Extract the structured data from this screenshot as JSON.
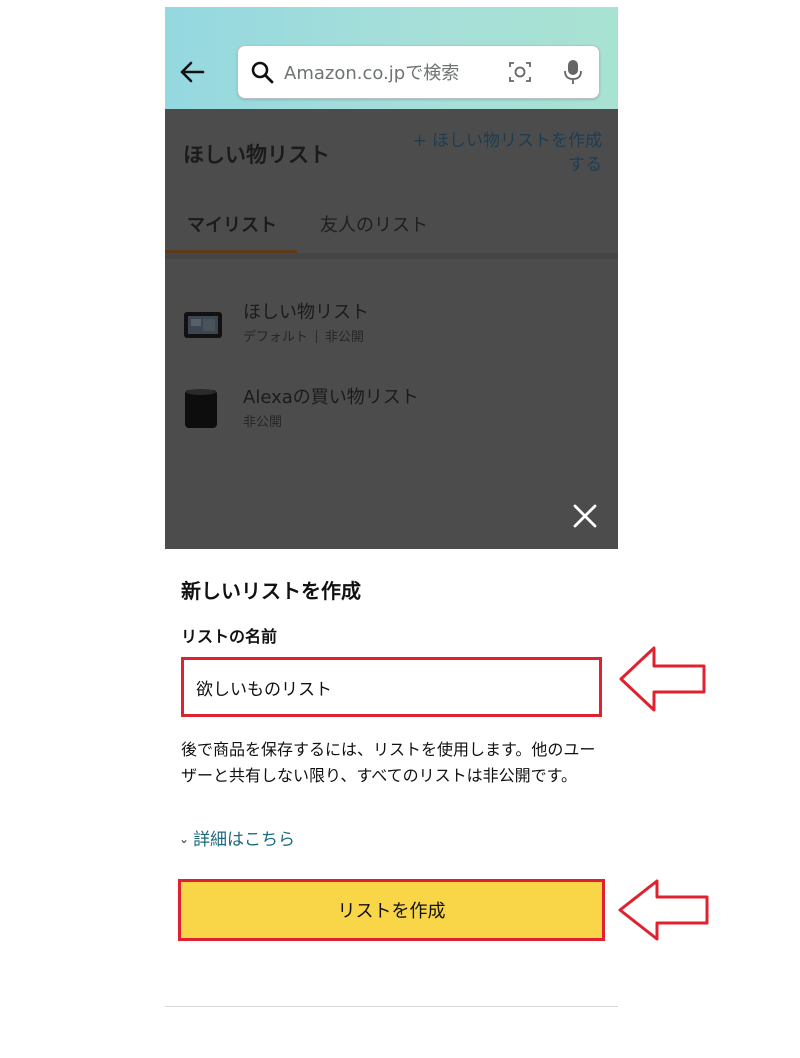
{
  "search": {
    "placeholder": "Amazon.co.jpで検索"
  },
  "wishlist_page": {
    "title": "ほしい物リスト",
    "create_link": "+ ほしい物リストを作成する",
    "tabs": [
      {
        "label": "マイリスト",
        "active": true
      },
      {
        "label": "友人のリスト",
        "active": false
      }
    ],
    "lists": [
      {
        "name": "ほしい物リスト",
        "meta": [
          "デフォルト",
          "非公開"
        ],
        "thumb_icon": "tablet-icon"
      },
      {
        "name": "Alexaの買い物リスト",
        "meta": [
          "非公開"
        ],
        "thumb_icon": "speaker-icon"
      }
    ]
  },
  "sheet": {
    "title": "新しいリストを作成",
    "name_label": "リストの名前",
    "name_value": "欲しいものリスト",
    "description": "後で商品を保存するには、リストを使用します。他のユーザーと共有しない限り、すべてのリストは非公開です。",
    "details_link": "詳細はこちら",
    "create_button": "リストを作成"
  },
  "colors": {
    "header_gradient": [
      "#94d8e0",
      "#a8e2d2"
    ],
    "overlay": "#4c4c4c",
    "button": "#f8d648",
    "highlight": "#e0212f",
    "link": "#1c6a7d"
  }
}
